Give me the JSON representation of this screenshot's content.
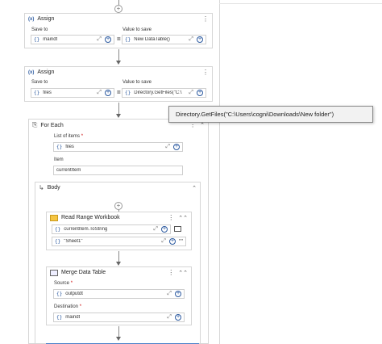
{
  "assign1": {
    "title": "Assign",
    "save_to_label": "Save to",
    "value_label": "Value to save",
    "save_to_value": "maindt",
    "value": "New DataTable()",
    "fx": "{}",
    "equals": "="
  },
  "assign2": {
    "title": "Assign",
    "save_to_label": "Save to",
    "value_label": "Value to save",
    "save_to_value": "files",
    "value": "Directory.GetFiles(\"C:\\",
    "fx": "{}",
    "equals": "="
  },
  "tooltip": {
    "text": "Directory.GetFiles(\"C:\\Users\\cogni\\Downloads\\New folder\")"
  },
  "foreach": {
    "title": "For Each",
    "list_label": "List of items",
    "list_value": "files",
    "item_label": "Item",
    "item_value": "currentItem",
    "fx": "{}",
    "required_mark": "*"
  },
  "body": {
    "title": "Body"
  },
  "read_range": {
    "title": "Read Range Workbook",
    "path_value": "currentItem.ToString",
    "sheet_value": "\"Sheet1\"",
    "fx": "{}",
    "quotes": "\"\""
  },
  "merge": {
    "title": "Merge Data Table",
    "source_label": "Source",
    "source_value": "outputdt",
    "dest_label": "Destination",
    "dest_value": "maindt",
    "fx": "{}",
    "required_mark": "*"
  },
  "icons": {
    "assign": "(x)",
    "kebab": "⋮",
    "expand": "⤢",
    "plus": "+",
    "collapse_up": "⌃",
    "collapse_double": "⌃⌃",
    "foreach": "⎘",
    "body": "↳"
  }
}
